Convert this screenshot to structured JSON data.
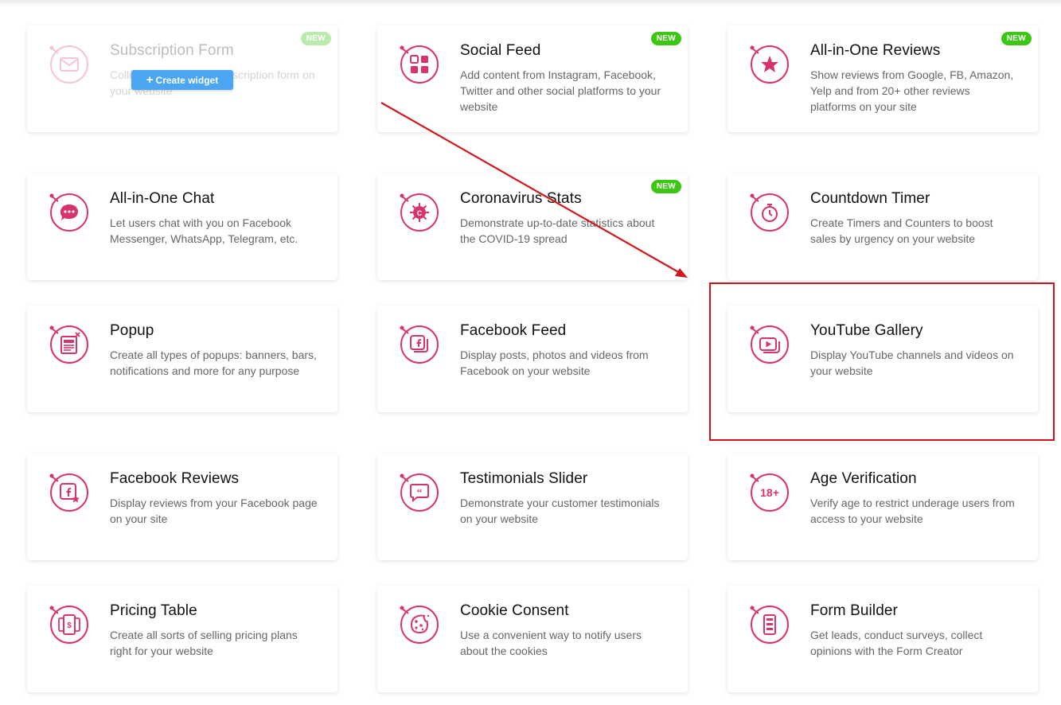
{
  "colors": {
    "accent": "#d8346a",
    "badge": "#3cc714",
    "button": "#4aa6f2",
    "annotation": "#d0161b"
  },
  "create_button_label": "Create widget",
  "cards": [
    {
      "title": "Subscription Form",
      "desc": "Collect emails with a subscription form on your website",
      "badge": "NEW",
      "icon": "envelope-icon"
    },
    {
      "title": "Social Feed",
      "desc": "Add content from Instagram, Facebook, Twitter and other social platforms to your website",
      "badge": "NEW",
      "icon": "social-grid-icon"
    },
    {
      "title": "All-in-One Reviews",
      "desc": "Show reviews from Google, FB, Amazon, Yelp and from 20+ other reviews platforms on your site",
      "badge": "NEW",
      "icon": "star-icon"
    },
    {
      "title": "All-in-One Chat",
      "desc": "Let users chat with you on Facebook Messenger, WhatsApp, Telegram, etc.",
      "badge": "",
      "icon": "chat-bubble-icon"
    },
    {
      "title": "Coronavirus Stats",
      "desc": "Demonstrate up-to-date statistics about the COVID-19 spread",
      "badge": "NEW",
      "icon": "virus-icon"
    },
    {
      "title": "Countdown Timer",
      "desc": "Create Timers and Counters to boost sales by urgency on your website",
      "badge": "",
      "icon": "stopwatch-icon"
    },
    {
      "title": "Popup",
      "desc": "Create all types of popups: banners, bars, notifications and more for any purpose",
      "badge": "",
      "icon": "popup-icon"
    },
    {
      "title": "Facebook Feed",
      "desc": "Display posts, photos and videos from Facebook on your website",
      "badge": "",
      "icon": "facebook-feed-icon"
    },
    {
      "title": "YouTube Gallery",
      "desc": "Display YouTube channels and videos on your website",
      "badge": "",
      "icon": "youtube-icon"
    },
    {
      "title": "Facebook Reviews",
      "desc": "Display reviews from your Facebook page on your site",
      "badge": "",
      "icon": "facebook-star-icon"
    },
    {
      "title": "Testimonials Slider",
      "desc": "Demonstrate your customer testimonials on your website",
      "badge": "",
      "icon": "quote-bubble-icon"
    },
    {
      "title": "Age Verification",
      "desc": "Verify age to restrict underage users from access to your website",
      "badge": "",
      "icon": "age-18-icon"
    },
    {
      "title": "Pricing Table",
      "desc": "Create all sorts of selling pricing plans right for your website",
      "badge": "",
      "icon": "pricing-cards-icon"
    },
    {
      "title": "Cookie Consent",
      "desc": "Use a convenient way to notify users about the cookies",
      "badge": "",
      "icon": "cookie-icon"
    },
    {
      "title": "Form Builder",
      "desc": "Get leads, conduct surveys, collect opinions with the Form Creator",
      "badge": "",
      "icon": "form-stack-icon"
    }
  ]
}
